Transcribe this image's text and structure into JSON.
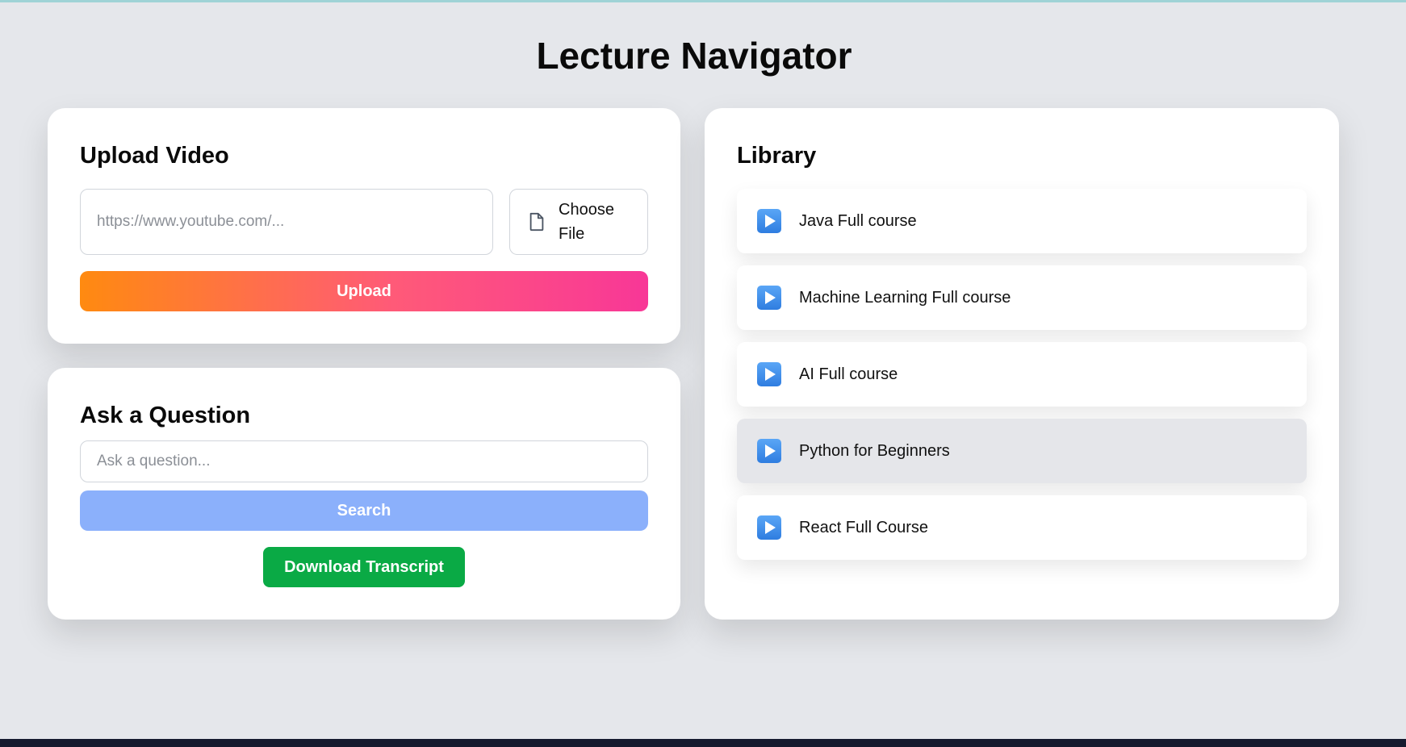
{
  "page": {
    "title": "Lecture Navigator"
  },
  "upload": {
    "title": "Upload Video",
    "url_placeholder": "https://www.youtube.com/...",
    "url_value": "",
    "choose_file_label": "Choose File",
    "upload_label": "Upload",
    "gradient_start": "#ff8a10",
    "gradient_end": "#f83797"
  },
  "question": {
    "title": "Ask a Question",
    "input_placeholder": "Ask a question...",
    "input_value": "",
    "search_label": "Search",
    "download_label": "Download Transcript",
    "search_color": "#8bb0fb",
    "download_color": "#0aaa45"
  },
  "library": {
    "title": "Library",
    "items": [
      {
        "label": "Java Full course",
        "icon": "play-button-icon",
        "active": false
      },
      {
        "label": "Machine Learning Full course",
        "icon": "play-button-icon",
        "active": false
      },
      {
        "label": "AI Full course",
        "icon": "play-button-icon",
        "active": false
      },
      {
        "label": "Python for Beginners",
        "icon": "play-button-icon",
        "active": true
      },
      {
        "label": "React Full Course",
        "icon": "play-button-icon",
        "active": false
      }
    ]
  }
}
